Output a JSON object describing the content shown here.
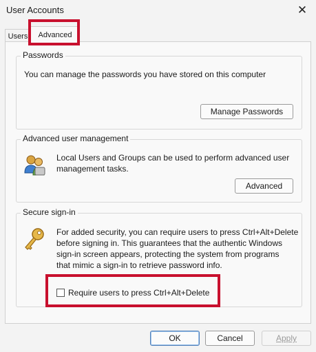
{
  "window": {
    "title": "User Accounts",
    "close_icon": "close-icon"
  },
  "tabs": [
    {
      "label": "Users",
      "selected": false
    },
    {
      "label": "Advanced",
      "selected": true
    }
  ],
  "passwords": {
    "title": "Passwords",
    "text": "You can manage the passwords you have stored on this computer",
    "button": "Manage Passwords"
  },
  "advanced_mgmt": {
    "title": "Advanced user management",
    "text_line1": "Local Users and Groups can be used to perform advanced user",
    "text_line2": "management tasks.",
    "button": "Advanced",
    "icon": "users-group-icon"
  },
  "secure_signin": {
    "title": "Secure sign-in",
    "text_line1": "For added security, you can require users to press Ctrl+Alt+Delete",
    "text_line2": "before signing in. This guarantees that the authentic Windows",
    "text_line3": "sign-in screen appears, protecting the system from programs",
    "text_line4": "that mimic a sign-in to retrieve password info.",
    "checkbox_label": "Require users to press Ctrl+Alt+Delete",
    "checkbox_checked": false,
    "icon": "key-icon"
  },
  "footer": {
    "ok": "OK",
    "cancel": "Cancel",
    "apply": "Apply"
  },
  "colors": {
    "highlight": "#c8102e",
    "primary_border": "#4f7fb8"
  }
}
